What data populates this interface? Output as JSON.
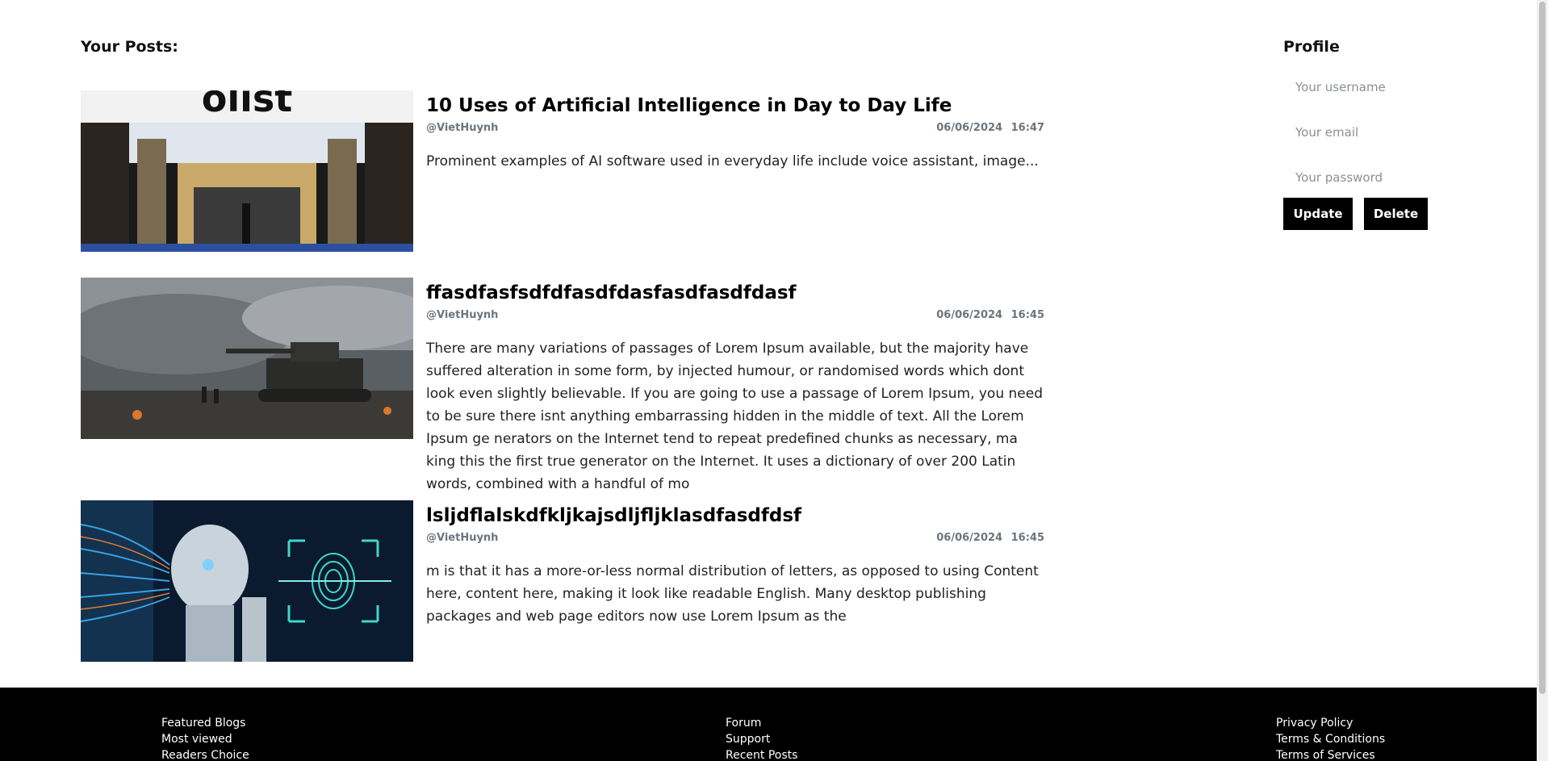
{
  "posts_heading": "Your Posts:",
  "posts": [
    {
      "title": "10 Uses of Artificial Intelligence in Day to Day Life",
      "author": "@VietHuynh",
      "date": "06/06/2024 16:47",
      "excerpt": "Prominent examples of AI software used in everyday life include voice assistant, image...",
      "thumb_text": "olist"
    },
    {
      "title": "ffasdfasfsdfdfasdfdasfasdfasdfdasf",
      "author": "@VietHuynh",
      "date": "06/06/2024 16:45",
      "excerpt": "There are many variations of passages of Lorem Ipsum available, but the majority have suffered alteration in some form, by injected humour, or randomised words which dont look even slightly believable. If you are going to use a passage of Lorem Ipsum, you need to be sure there isnt anything embarrassing hidden in the middle of text. All the Lorem Ipsum ge nerators on the Internet tend to repeat predefined chunks as necessary, ma king this the first true generator on the Internet. It uses a dictionary of over 200 Latin words, combined with a handful of mo"
    },
    {
      "title": "lsljdflalskdfkljkajsdljfljklasdfasdfdsf",
      "author": "@VietHuynh",
      "date": "06/06/2024 16:45",
      "excerpt": "m is that it has a more-or-less normal distribution of letters, as opposed to using Content here, content here, making it look like readable English. Many desktop publishing packages and web page editors now use Lorem Ipsum as the"
    }
  ],
  "profile": {
    "title": "Profile",
    "username_placeholder": "Your username",
    "email_placeholder": "Your email",
    "password_placeholder": "Your password",
    "update_label": "Update",
    "delete_label": "Delete"
  },
  "footer": {
    "col1": [
      "Featured Blogs",
      "Most viewed",
      "Readers Choice"
    ],
    "col2": [
      "Forum",
      "Support",
      "Recent Posts"
    ],
    "col3": [
      "Privacy Policy",
      "Terms & Conditions",
      "Terms of Services"
    ]
  },
  "colors": {
    "button_bg": "#000000",
    "footer_bg": "#000000",
    "meta_text": "#6c757d"
  }
}
